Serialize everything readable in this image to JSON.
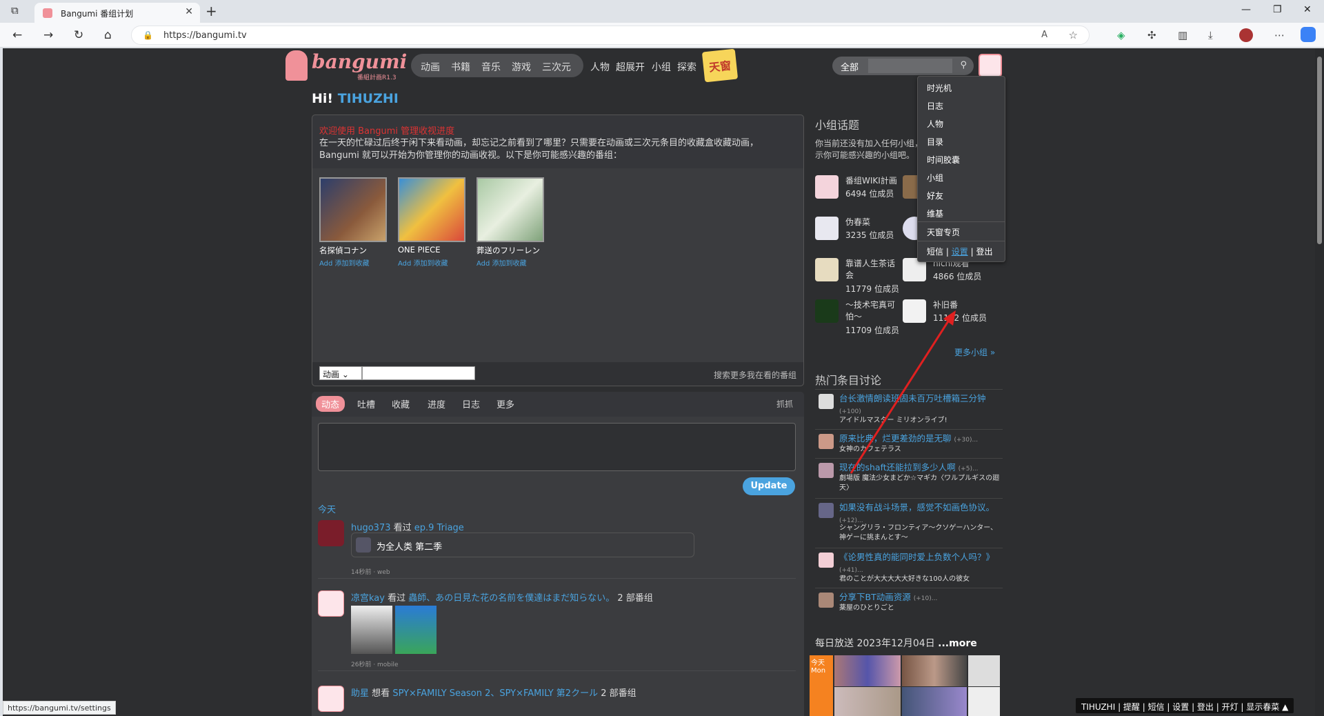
{
  "browser": {
    "tab_title": "Bangumi 番组计划",
    "url": "https://bangumi.tv",
    "status_url": "https://bangumi.tv/settings"
  },
  "header": {
    "logo": "bangumi",
    "logo_sub": "番組計画R1.3",
    "nav": [
      "动画",
      "书籍",
      "音乐",
      "游戏",
      "三次元"
    ],
    "subnav": [
      "人物",
      "超展开",
      "小组",
      "探索"
    ],
    "tianchuang": "天窗",
    "search_cat": "全部"
  },
  "hi": {
    "prefix": "Hi!",
    "user": "TIHUZHI"
  },
  "welcome": {
    "title": "欢迎使用 Bangumi 管理收视进度",
    "desc": "在一天的忙碌过后终于闲下来看动画，却忘记之前看到了哪里？只需要在动画或三次元条目的收藏盒收藏动画，Bangumi 就可以开始为你管理你的动画收视。以下是你可能感兴趣的番组：",
    "items": [
      {
        "name": "名探偵コナン",
        "add": "Add 添加到收藏"
      },
      {
        "name": "ONE PIECE",
        "add": "Add 添加到收藏"
      },
      {
        "name": "葬送のフリーレン",
        "add": "Add 添加到收藏"
      }
    ],
    "select": "动画",
    "more": "搜索更多我在看的番组"
  },
  "timeline": {
    "tabs": [
      "动态",
      "吐槽",
      "收藏",
      "进度",
      "日志",
      "更多"
    ],
    "grab": "抓抓",
    "update": "Update",
    "today": "今天",
    "rows": [
      {
        "user": "hugo373",
        "action": "看过",
        "target": "ep.9 Triage",
        "card": "为全人类 第二季",
        "meta": "14秒前 · web"
      },
      {
        "user": "凉宫kay",
        "action": "看过",
        "target": "蟲師、あの日見た花の名前を僕達はまだ知らない。",
        "suffix": "2 部番组",
        "meta": "26秒前 · mobile"
      },
      {
        "user": "助星",
        "action": "想看",
        "target": "SPY×FAMILY Season 2、SPY×FAMILY 第2クール",
        "suffix": "2 部番组"
      }
    ]
  },
  "groups": {
    "title": "小组话题",
    "desc": "你当前还没有加入任何小组，这里显示你可能感兴趣的小组吧。",
    "items": [
      {
        "name": "番组WIKI計画",
        "count": "6494 位成员"
      },
      {
        "name": "",
        "count": ""
      },
      {
        "name": "伪春菜",
        "count": "3235 位成员"
      },
      {
        "name": "",
        "count": ""
      },
      {
        "name": "靠谱人生茶话会",
        "count": "11779 位成员"
      },
      {
        "name": "hichi观看",
        "count": "4866 位成员"
      },
      {
        "name": "～技术宅真可怕～",
        "count": "11709 位成员"
      },
      {
        "name": "补旧番",
        "count": "11162 位成员"
      }
    ],
    "more": "更多小组 »"
  },
  "hot": {
    "title": "热门条目讨论",
    "items": [
      {
        "title": "台长激情朗读班固未百万吐槽箱三分钟",
        "count": "(+100)",
        "sub": "アイドルマスター ミリオンライブ!"
      },
      {
        "title": "原来比典，烂更差劲的是无聊",
        "count": "(+30)...",
        "sub": "女神のカフェテラス"
      },
      {
        "title": "现在的shaft还能拉到多少人啊",
        "count": "(+5)...",
        "sub": "劇場版 魔法少女まどか☆マギカ〈ワルプルギスの廻天〉"
      },
      {
        "title": "如果没有战斗场景，感觉不如画色协议。",
        "count": "(+12)...",
        "sub": "シャングリラ・フロンティア～クソゲーハンター、神ゲーに挑まんとす～"
      },
      {
        "title": "《论男性真的能同时爱上负数个人吗？》",
        "count": "(+41)...",
        "sub": "君のことが大大大大大好きな100人の彼女"
      },
      {
        "title": "分享下BT动画资源",
        "count": "(+10)...",
        "sub": "薬屋のひとりごと"
      }
    ]
  },
  "daily": {
    "title": "每日放送",
    "date": "2023年12月04日",
    "more": "...more",
    "today": "今天",
    "day": "Mon"
  },
  "dropdown": {
    "items": [
      "时光机",
      "日志",
      "人物",
      "目录",
      "时间胶囊",
      "小组",
      "好友",
      "维基"
    ],
    "special": "天窗专页",
    "pm": "短信",
    "sep": "|",
    "settings": "设置",
    "logout": "登出"
  },
  "bottombar": "TIHUZHI | 提醒 | 短信 | 设置 | 登出 | 开灯 | 显示春菜 ▲",
  "colors": {
    "accent": "#f09199",
    "link": "#4aa3df",
    "bg": "#2d2e30"
  }
}
